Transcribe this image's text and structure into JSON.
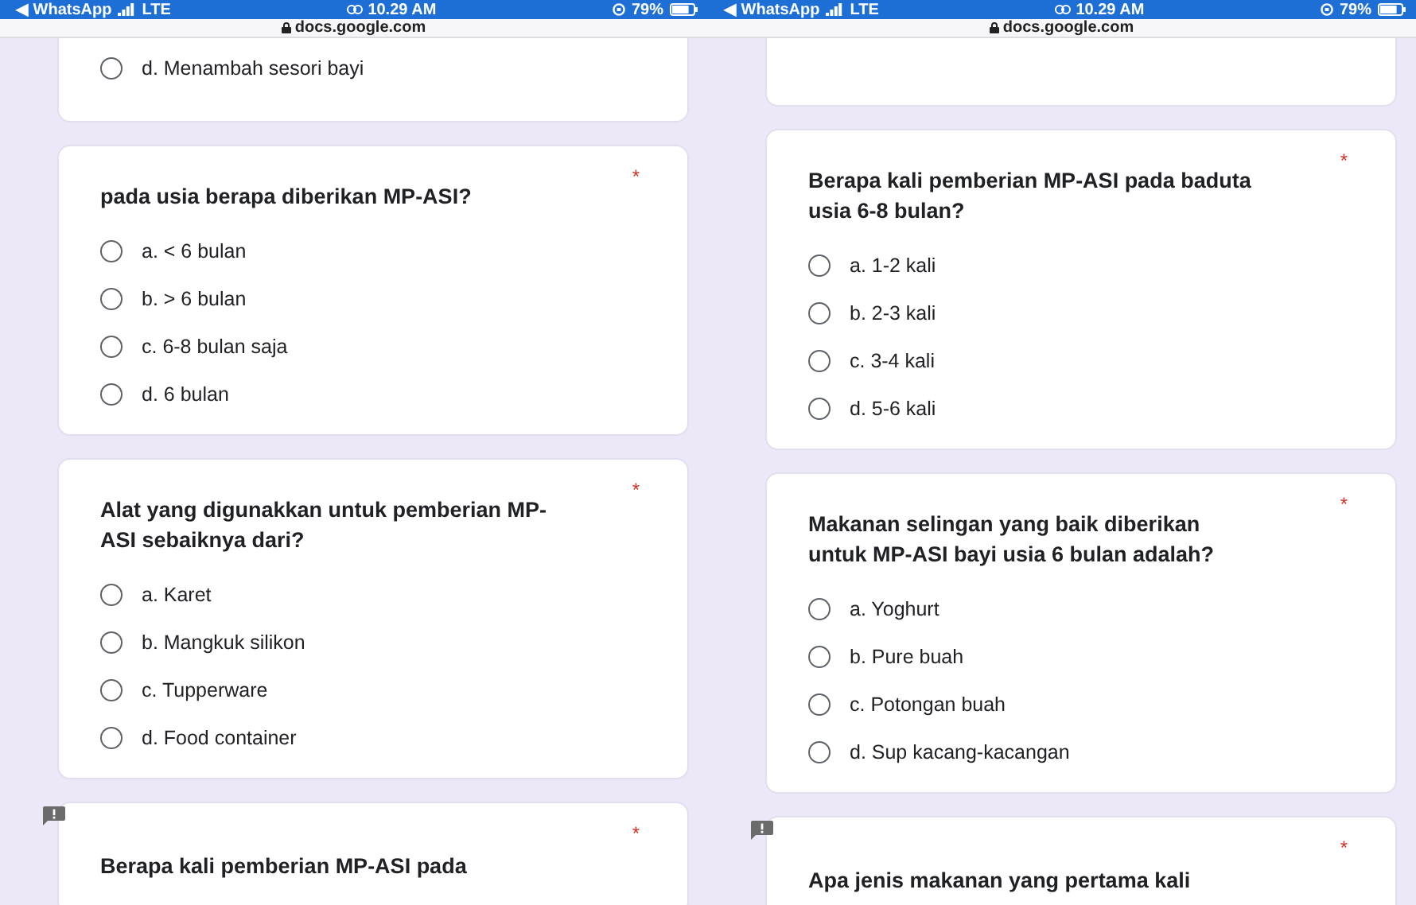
{
  "panels": [
    {
      "status_bar": {
        "back_label": "◀ WhatsApp",
        "network": "LTE",
        "time": "10.29 AM",
        "battery": "79%"
      },
      "address": "docs.google.com",
      "cards": [
        {
          "kind": "fragment",
          "options": [
            {
              "label": "d. Menambah sesori bayi",
              "selected": false
            }
          ]
        },
        {
          "kind": "question",
          "question": "pada usia berapa diberikan MP-ASI?",
          "required_mark": "*",
          "options": [
            {
              "label": "a. < 6 bulan",
              "selected": false
            },
            {
              "label": "b. > 6 bulan",
              "selected": false
            },
            {
              "label": "c. 6-8 bulan saja",
              "selected": false
            },
            {
              "label": "d. 6 bulan",
              "selected": false
            }
          ]
        },
        {
          "kind": "question",
          "question": "Alat yang digunakkan untuk pemberian MP-ASI sebaiknya dari?",
          "required_mark": "*",
          "options": [
            {
              "label": "a. Karet",
              "selected": false
            },
            {
              "label": "b. Mangkuk silikon",
              "selected": false
            },
            {
              "label": "c. Tupperware",
              "selected": false
            },
            {
              "label": "d. Food container",
              "selected": false
            }
          ]
        },
        {
          "kind": "cut",
          "question": "Berapa kali pemberian MP-ASI pada",
          "required_mark": "*",
          "feedback_button": true
        }
      ]
    },
    {
      "status_bar": {
        "back_label": "◀ WhatsApp",
        "network": "LTE",
        "time": "10.29 AM",
        "battery": "79%"
      },
      "address": "docs.google.com",
      "cards": [
        {
          "kind": "fragment"
        },
        {
          "kind": "question",
          "question": "Berapa kali pemberian MP-ASI pada baduta usia 6-8 bulan?",
          "required_mark": "*",
          "options": [
            {
              "label": "a. 1-2 kali",
              "selected": false
            },
            {
              "label": "b. 2-3 kali",
              "selected": false
            },
            {
              "label": "c. 3-4 kali",
              "selected": false
            },
            {
              "label": "d. 5-6 kali",
              "selected": false
            }
          ]
        },
        {
          "kind": "question",
          "question": "Makanan selingan yang baik diberikan untuk MP-ASI bayi usia 6 bulan adalah?",
          "required_mark": "*",
          "options": [
            {
              "label": "a. Yoghurt",
              "selected": false
            },
            {
              "label": "b. Pure buah",
              "selected": false
            },
            {
              "label": "c. Potongan buah",
              "selected": false
            },
            {
              "label": "d. Sup kacang-kacangan",
              "selected": false
            }
          ]
        },
        {
          "kind": "cut",
          "question": "Apa jenis makanan yang pertama kali",
          "required_mark": "*",
          "feedback_button": true
        }
      ]
    }
  ]
}
